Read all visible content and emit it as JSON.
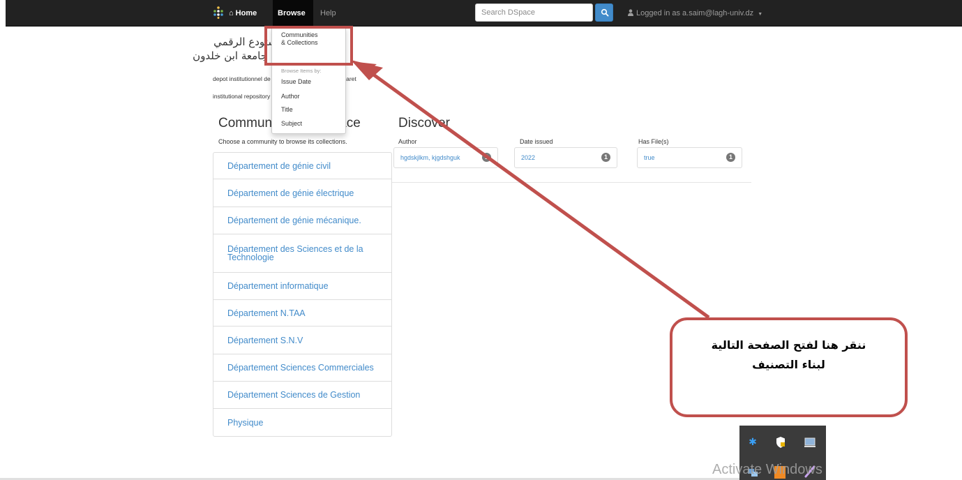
{
  "navbar": {
    "home_label": "Home",
    "browse_label": "Browse",
    "help_label": "Help",
    "search_placeholder": "Search DSpace",
    "login_text": "Logged in as a.saim@lagh-univ.dz"
  },
  "header": {
    "arabic_line1": "المستودع الرقمي",
    "arabic_line2": "جامعة ابن خلدون",
    "depot_text": "depot institutionnel de l'universite Ibn Khaldoune Tiaret",
    "institutional_text": "institutional repository"
  },
  "browse_menu": {
    "communities_line1": "Communities",
    "communities_line2": "& Collections",
    "items_header": "Browse Items by:",
    "items": [
      "Issue Date",
      "Author",
      "Title",
      "Subject"
    ]
  },
  "communities": {
    "heading": "Communities in DSpace",
    "subtitle": "Choose a community to browse its collections.",
    "items": [
      "Département de génie civil",
      "Département de génie électrique",
      "Département de génie mécanique.",
      "Département des Sciences et de la Technologie",
      "Département informatique",
      "Département N.TAA",
      "Département S.N.V",
      "Département Sciences Commerciales",
      "Département Sciences de Gestion",
      "Physique"
    ]
  },
  "discover": {
    "heading": "Discover",
    "facets": [
      {
        "label": "Author",
        "value": "hgdskjlkm, kjgdshguk",
        "count": "1"
      },
      {
        "label": "Date issued",
        "value": "2022",
        "count": "1"
      },
      {
        "label": "Has File(s)",
        "value": "true",
        "count": "1"
      }
    ]
  },
  "callout": {
    "line1": "ننقر هنا لفتح الصفحة التالية",
    "line2": "لبناء التصنيف"
  },
  "watermark": "Activate Windows",
  "colors": {
    "navbar": "#222222",
    "link": "#428bca",
    "annotation": "#c0504d"
  }
}
